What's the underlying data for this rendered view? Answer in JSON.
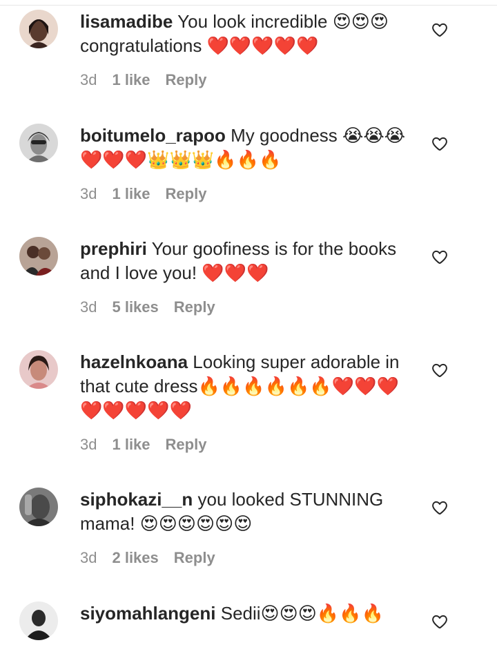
{
  "comments": [
    {
      "username": "lisamadibe",
      "text": "You look incredible 😍😍😍 congratulations ❤️❤️❤️❤️❤️",
      "time": "3d",
      "likes": "1 like",
      "reply": "Reply",
      "avatar_color": "#5a3b2e",
      "avatar_icon": "profile-photo"
    },
    {
      "username": "boitumelo_rapoo",
      "text": "My goodness 😭😭😭❤️❤️❤️👑👑👑🔥🔥🔥",
      "time": "3d",
      "likes": "1 like",
      "reply": "Reply",
      "avatar_color": "#9a9a9a",
      "avatar_icon": "profile-photo"
    },
    {
      "username": "prephiri",
      "text": "Your goofiness is for the books and I love you! ❤️❤️❤️",
      "time": "3d",
      "likes": "5 likes",
      "reply": "Reply",
      "avatar_color": "#6b4a3a",
      "avatar_icon": "profile-photo"
    },
    {
      "username": "hazelnkoana",
      "text": "Looking super adorable in that cute dress🔥🔥🔥🔥🔥🔥❤️❤️❤️❤️❤️❤️❤️❤️",
      "time": "3d",
      "likes": "1 like",
      "reply": "Reply",
      "avatar_color": "#c78a7a",
      "avatar_icon": "profile-photo"
    },
    {
      "username": "siphokazi__n",
      "text": "you looked STUNNING mama! 😍😍😍😍😍😍",
      "time": "3d",
      "likes": "2 likes",
      "reply": "Reply",
      "avatar_color": "#4a4a4a",
      "avatar_icon": "profile-photo"
    },
    {
      "username": "siyomahlangeni",
      "text": "Sedii😍😍😍🔥🔥🔥",
      "avatar_color": "#2b2b2b",
      "avatar_icon": "profile-photo"
    }
  ],
  "like_icon": "heart-outline-icon",
  "colors": {
    "text": "#262626",
    "meta": "#8e8e8e",
    "divider": "#e6e6e6"
  }
}
